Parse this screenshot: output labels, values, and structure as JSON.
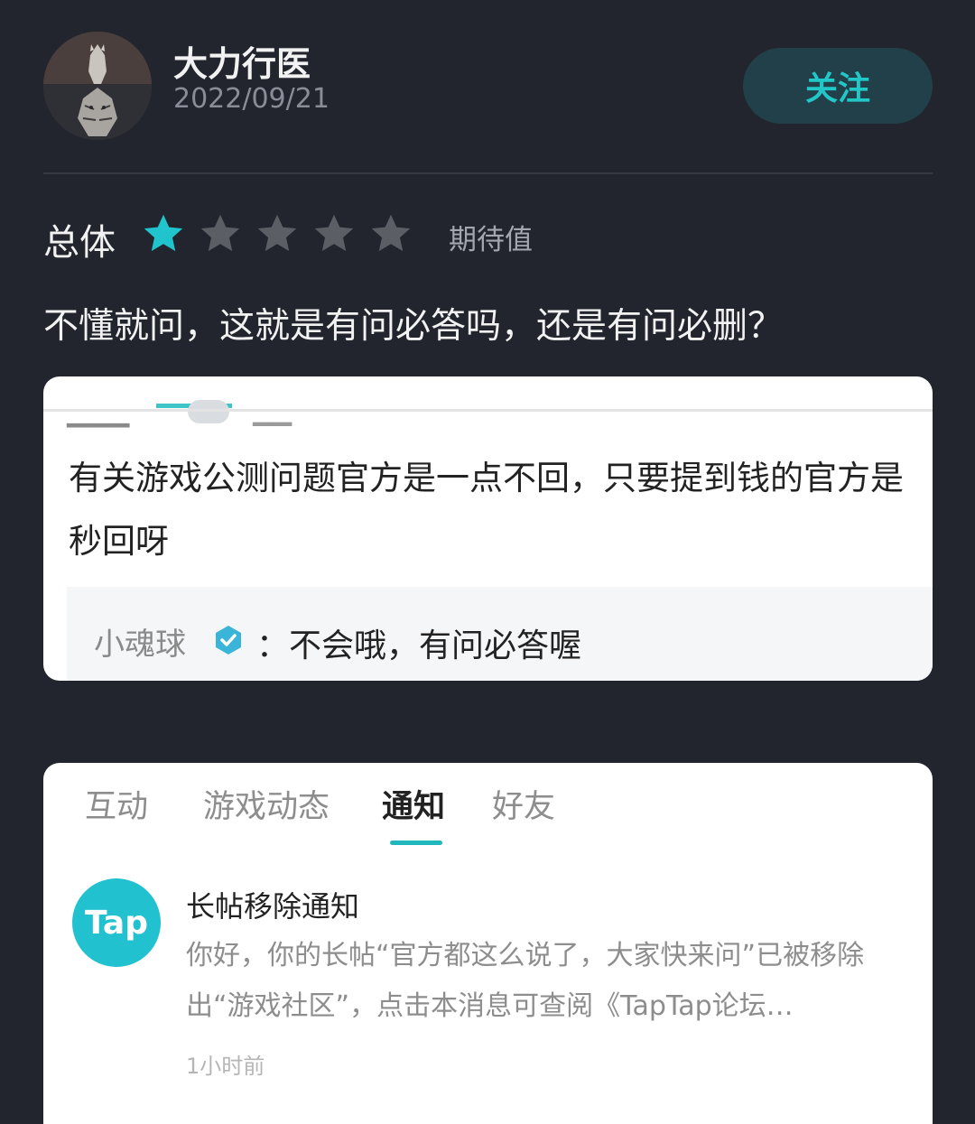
{
  "post": {
    "user_name": "大力行医",
    "date": "2022/09/21",
    "follow_label": "关注",
    "rating_label": "总体",
    "rating_value": 1,
    "rating_max": 5,
    "expect_label": "期待值",
    "review_text": "不懂就问，这就是有问必答吗，还是有问必删？"
  },
  "screenshot1": {
    "comment": "有关游戏公测问题官方是一点不回，只要提到钱的官方是秒回呀",
    "reply_user": "小魂球",
    "reply_text": "：不会哦，有问必答喔"
  },
  "screenshot2": {
    "tabs": [
      {
        "label": "互动"
      },
      {
        "label": "游戏动态"
      },
      {
        "label": "通知"
      },
      {
        "label": "好友"
      }
    ],
    "active_tab": "通知",
    "notice": {
      "logo_text": "Tap",
      "title": "长帖移除通知",
      "body": "你好，你的长帖“官方都这么说了，大家快来问”已被移除出“游戏社区”，点击本消息可查阅《TapTap论坛…",
      "time": "1小时前"
    }
  },
  "colors": {
    "background": "#23252e",
    "accent": "#22c8c8",
    "star_active": "#1fc4cc",
    "star_inactive": "#5c5e66"
  }
}
